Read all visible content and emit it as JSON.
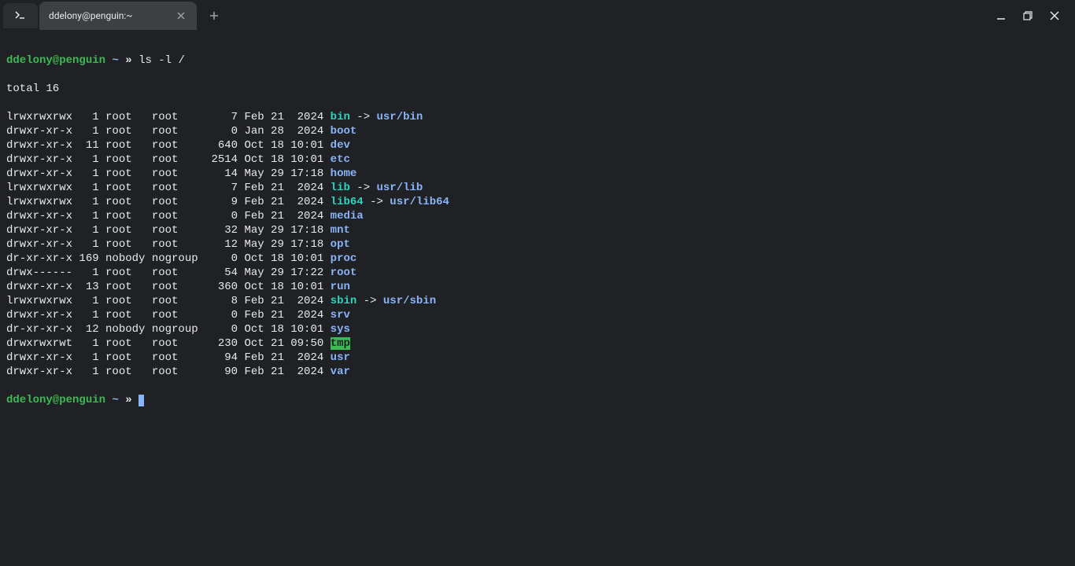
{
  "titlebar": {
    "tab_title": "ddelony@penguin:~"
  },
  "prompt": {
    "user_host": "ddelony@penguin",
    "path": "~",
    "arrow": "»",
    "command": "ls -l /"
  },
  "prompt2": {
    "user_host": "ddelony@penguin",
    "path": "~",
    "arrow": "»"
  },
  "total_line": "total 16",
  "listing": [
    {
      "perms": "lrwxrwxrwx",
      "links": "  1",
      "owner": "root  ",
      "group": "root   ",
      "size": "    7",
      "date": "Feb 21  2024",
      "name": "bin",
      "type": "symlink",
      "target": "usr/bin"
    },
    {
      "perms": "drwxr-xr-x",
      "links": "  1",
      "owner": "root  ",
      "group": "root   ",
      "size": "    0",
      "date": "Jan 28  2024",
      "name": "boot",
      "type": "dir"
    },
    {
      "perms": "drwxr-xr-x",
      "links": " 11",
      "owner": "root  ",
      "group": "root   ",
      "size": "  640",
      "date": "Oct 18 10:01",
      "name": "dev",
      "type": "dir"
    },
    {
      "perms": "drwxr-xr-x",
      "links": "  1",
      "owner": "root  ",
      "group": "root   ",
      "size": " 2514",
      "date": "Oct 18 10:01",
      "name": "etc",
      "type": "dir"
    },
    {
      "perms": "drwxr-xr-x",
      "links": "  1",
      "owner": "root  ",
      "group": "root   ",
      "size": "   14",
      "date": "May 29 17:18",
      "name": "home",
      "type": "dir"
    },
    {
      "perms": "lrwxrwxrwx",
      "links": "  1",
      "owner": "root  ",
      "group": "root   ",
      "size": "    7",
      "date": "Feb 21  2024",
      "name": "lib",
      "type": "symlink",
      "target": "usr/lib"
    },
    {
      "perms": "lrwxrwxrwx",
      "links": "  1",
      "owner": "root  ",
      "group": "root   ",
      "size": "    9",
      "date": "Feb 21  2024",
      "name": "lib64",
      "type": "symlink",
      "target": "usr/lib64"
    },
    {
      "perms": "drwxr-xr-x",
      "links": "  1",
      "owner": "root  ",
      "group": "root   ",
      "size": "    0",
      "date": "Feb 21  2024",
      "name": "media",
      "type": "dir"
    },
    {
      "perms": "drwxr-xr-x",
      "links": "  1",
      "owner": "root  ",
      "group": "root   ",
      "size": "   32",
      "date": "May 29 17:18",
      "name": "mnt",
      "type": "dir"
    },
    {
      "perms": "drwxr-xr-x",
      "links": "  1",
      "owner": "root  ",
      "group": "root   ",
      "size": "   12",
      "date": "May 29 17:18",
      "name": "opt",
      "type": "dir"
    },
    {
      "perms": "dr-xr-xr-x",
      "links": "169",
      "owner": "nobody",
      "group": "nogroup",
      "size": "    0",
      "date": "Oct 18 10:01",
      "name": "proc",
      "type": "dir"
    },
    {
      "perms": "drwx------",
      "links": "  1",
      "owner": "root  ",
      "group": "root   ",
      "size": "   54",
      "date": "May 29 17:22",
      "name": "root",
      "type": "dir"
    },
    {
      "perms": "drwxr-xr-x",
      "links": " 13",
      "owner": "root  ",
      "group": "root   ",
      "size": "  360",
      "date": "Oct 18 10:01",
      "name": "run",
      "type": "dir"
    },
    {
      "perms": "lrwxrwxrwx",
      "links": "  1",
      "owner": "root  ",
      "group": "root   ",
      "size": "    8",
      "date": "Feb 21  2024",
      "name": "sbin",
      "type": "symlink",
      "target": "usr/sbin"
    },
    {
      "perms": "drwxr-xr-x",
      "links": "  1",
      "owner": "root  ",
      "group": "root   ",
      "size": "    0",
      "date": "Feb 21  2024",
      "name": "srv",
      "type": "dir"
    },
    {
      "perms": "dr-xr-xr-x",
      "links": " 12",
      "owner": "nobody",
      "group": "nogroup",
      "size": "    0",
      "date": "Oct 18 10:01",
      "name": "sys",
      "type": "dir"
    },
    {
      "perms": "drwxrwxrwt",
      "links": "  1",
      "owner": "root  ",
      "group": "root   ",
      "size": "  230",
      "date": "Oct 21 09:50",
      "name": "tmp",
      "type": "sticky"
    },
    {
      "perms": "drwxr-xr-x",
      "links": "  1",
      "owner": "root  ",
      "group": "root   ",
      "size": "   94",
      "date": "Feb 21  2024",
      "name": "usr",
      "type": "dir"
    },
    {
      "perms": "drwxr-xr-x",
      "links": "  1",
      "owner": "root  ",
      "group": "root   ",
      "size": "   90",
      "date": "Feb 21  2024",
      "name": "var",
      "type": "dir"
    }
  ]
}
